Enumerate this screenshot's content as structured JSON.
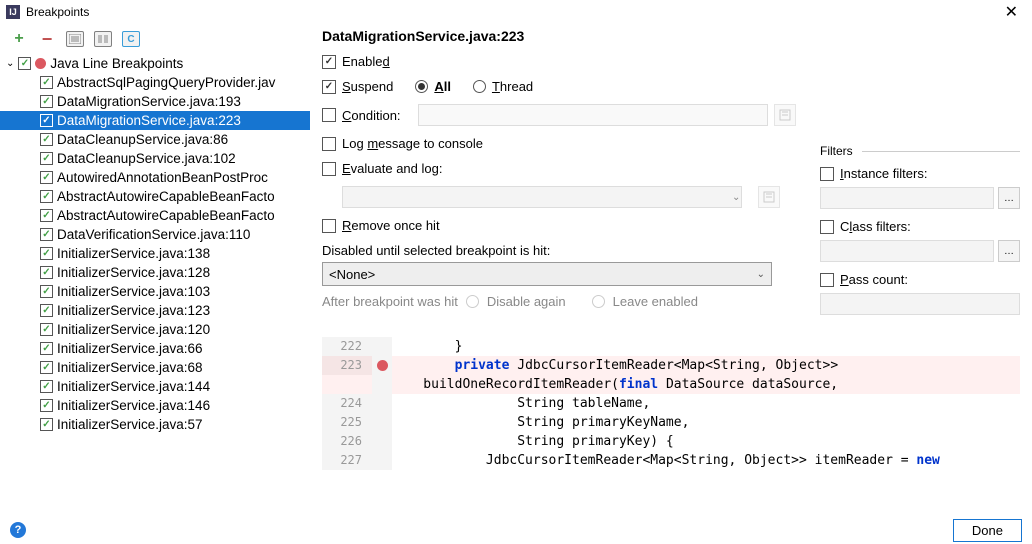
{
  "window": {
    "title": "Breakpoints"
  },
  "tree": {
    "root_label": "Java Line Breakpoints",
    "items": [
      "AbstractSqlPagingQueryProvider.jav",
      "DataMigrationService.java:193",
      "DataMigrationService.java:223",
      "DataCleanupService.java:86",
      "DataCleanupService.java:102",
      "AutowiredAnnotationBeanPostProc",
      "AbstractAutowireCapableBeanFacto",
      "AbstractAutowireCapableBeanFacto",
      "DataVerificationService.java:110",
      "InitializerService.java:138",
      "InitializerService.java:128",
      "InitializerService.java:103",
      "InitializerService.java:123",
      "InitializerService.java:120",
      "InitializerService.java:66",
      "InitializerService.java:68",
      "InitializerService.java:144",
      "InitializerService.java:146",
      "InitializerService.java:57"
    ],
    "selected_index": 2
  },
  "details": {
    "title": "DataMigrationService.java:223",
    "enabled_label_pre": "Enable",
    "enabled_label_u": "d",
    "suspend_label_u": "S",
    "suspend_label_post": "uspend",
    "all_label_u": "A",
    "all_label_post": "ll",
    "thread_label_u": "T",
    "thread_label_post": "hread",
    "condition_label_u": "C",
    "condition_label_post": "ondition:",
    "log_label_pre": "Log ",
    "log_label_u": "m",
    "log_label_post": "essage to console",
    "eval_label_u": "E",
    "eval_label_post": "valuate and log:",
    "remove_label_u": "R",
    "remove_label_post": "emove once hit",
    "disabled_until_label": "Disabled until selected breakpoint is hit:",
    "none_option": "<None>",
    "after_label": "After breakpoint was hit",
    "disable_again_label": "Disable again",
    "leave_enabled_label": "Leave enabled"
  },
  "filters": {
    "section_label": "Filters",
    "instance_label_u": "I",
    "instance_label_post": "nstance filters:",
    "class_label_pre": "C",
    "class_label_u": "l",
    "class_label_post": "ass filters:",
    "pass_label_u": "P",
    "pass_label_post": "ass count:"
  },
  "code": {
    "lines": [
      {
        "num": "222",
        "text": "        }"
      },
      {
        "num": "223",
        "bp": true,
        "hl": true,
        "html": "        <span class='kw'>private</span> JdbcCursorItemReader&lt;Map&lt;String, Object&gt;&gt; "
      },
      {
        "num": "",
        "hl": true,
        "html": "    buildOneRecordItemReader(<span class='kw'>final</span> DataSource dataSource,"
      },
      {
        "num": "224",
        "text": "                String tableName,"
      },
      {
        "num": "225",
        "text": "                String primaryKeyName,"
      },
      {
        "num": "226",
        "text": "                String primaryKey) {"
      },
      {
        "num": "227",
        "html": "            JdbcCursorItemReader&lt;Map&lt;String, Object&gt;&gt; itemReader = <span class='kw'>new</span>"
      }
    ]
  },
  "footer": {
    "done": "Done"
  }
}
